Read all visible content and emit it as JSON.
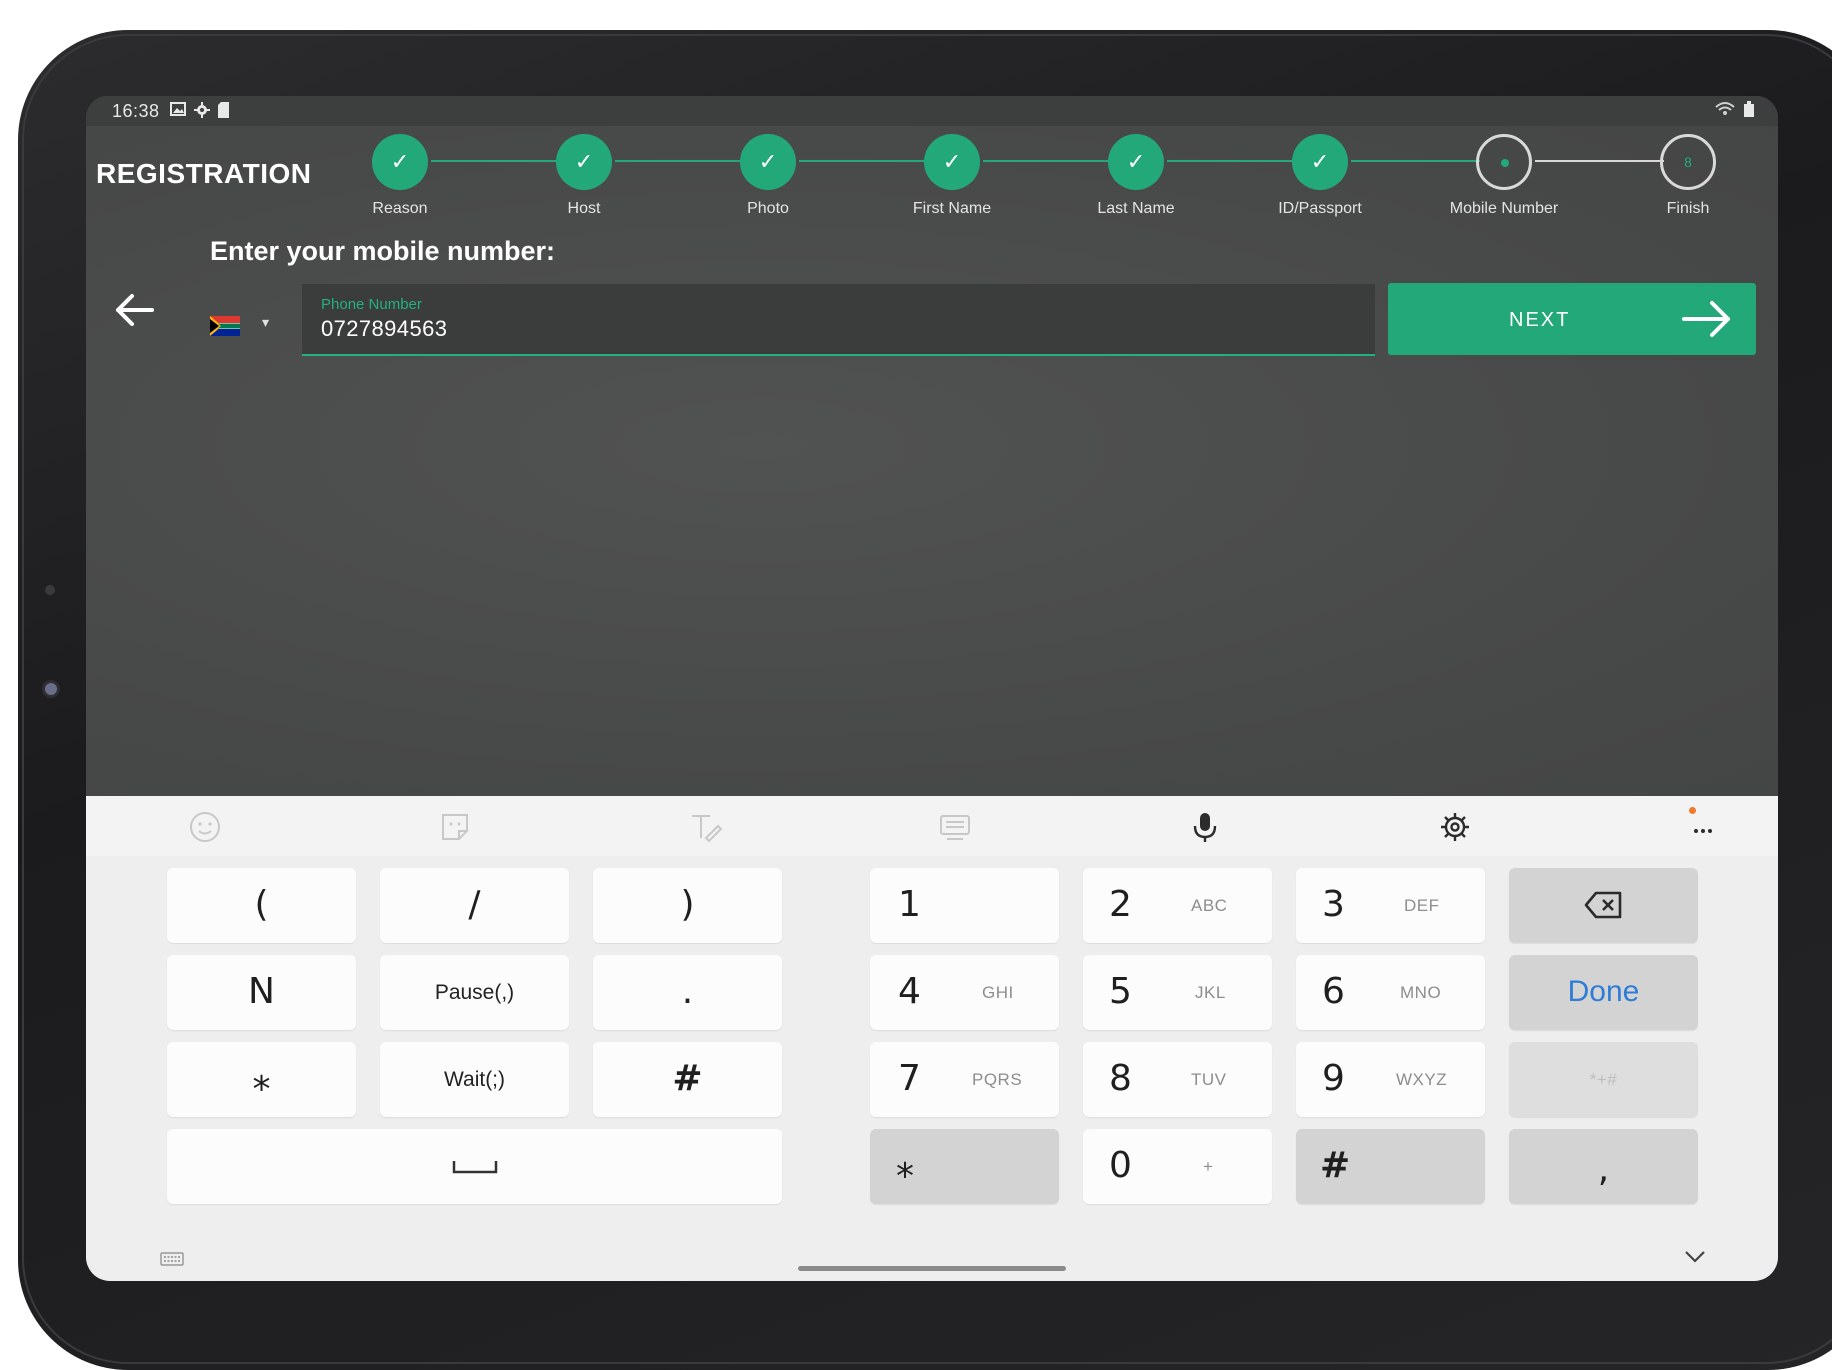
{
  "status_bar": {
    "time": "16:38"
  },
  "header": {
    "title": "REGISTRATION"
  },
  "stepper": {
    "steps": [
      {
        "label": "Reason",
        "state": "done"
      },
      {
        "label": "Host",
        "state": "done"
      },
      {
        "label": "Photo",
        "state": "done"
      },
      {
        "label": "First Name",
        "state": "done"
      },
      {
        "label": "Last Name",
        "state": "done"
      },
      {
        "label": "ID/Passport",
        "state": "done"
      },
      {
        "label": "Mobile Number",
        "state": "current"
      },
      {
        "label": "Finish",
        "state": "future",
        "number": "8"
      }
    ]
  },
  "form": {
    "prompt": "Enter your mobile number:",
    "phone_label": "Phone Number",
    "phone_value": "0727894563",
    "country_flag": "south-africa",
    "next_label": "NEXT"
  },
  "keyboard": {
    "toolbar": [
      "emoji-icon",
      "sticker-icon",
      "handwriting-icon",
      "keyboard-layout-icon",
      "microphone-icon",
      "gear-icon",
      "more-icon"
    ],
    "symbols": {
      "open_paren": "(",
      "slash": "/",
      "close_paren": ")",
      "n": "N",
      "pause": "Pause(,)",
      "dot": ".",
      "asterisk": "⁎",
      "wait": "Wait(;)",
      "hash": "#",
      "space": "␣"
    },
    "digits": [
      {
        "digit": "1",
        "letters": ""
      },
      {
        "digit": "2",
        "letters": "ABC"
      },
      {
        "digit": "3",
        "letters": "DEF"
      },
      {
        "digit": "4",
        "letters": "GHI"
      },
      {
        "digit": "5",
        "letters": "JKL"
      },
      {
        "digit": "6",
        "letters": "MNO"
      },
      {
        "digit": "7",
        "letters": "PQRS"
      },
      {
        "digit": "8",
        "letters": "TUV"
      },
      {
        "digit": "9",
        "letters": "WXYZ"
      },
      {
        "digit": "0",
        "letters": "+"
      }
    ],
    "star": "⁎",
    "hash": "#",
    "done_label": "Done",
    "symbols_toggle": "*+#",
    "comma": ","
  },
  "colors": {
    "accent": "#23a979",
    "background": "#4b4c4c",
    "done_blue": "#2f7cd7"
  }
}
